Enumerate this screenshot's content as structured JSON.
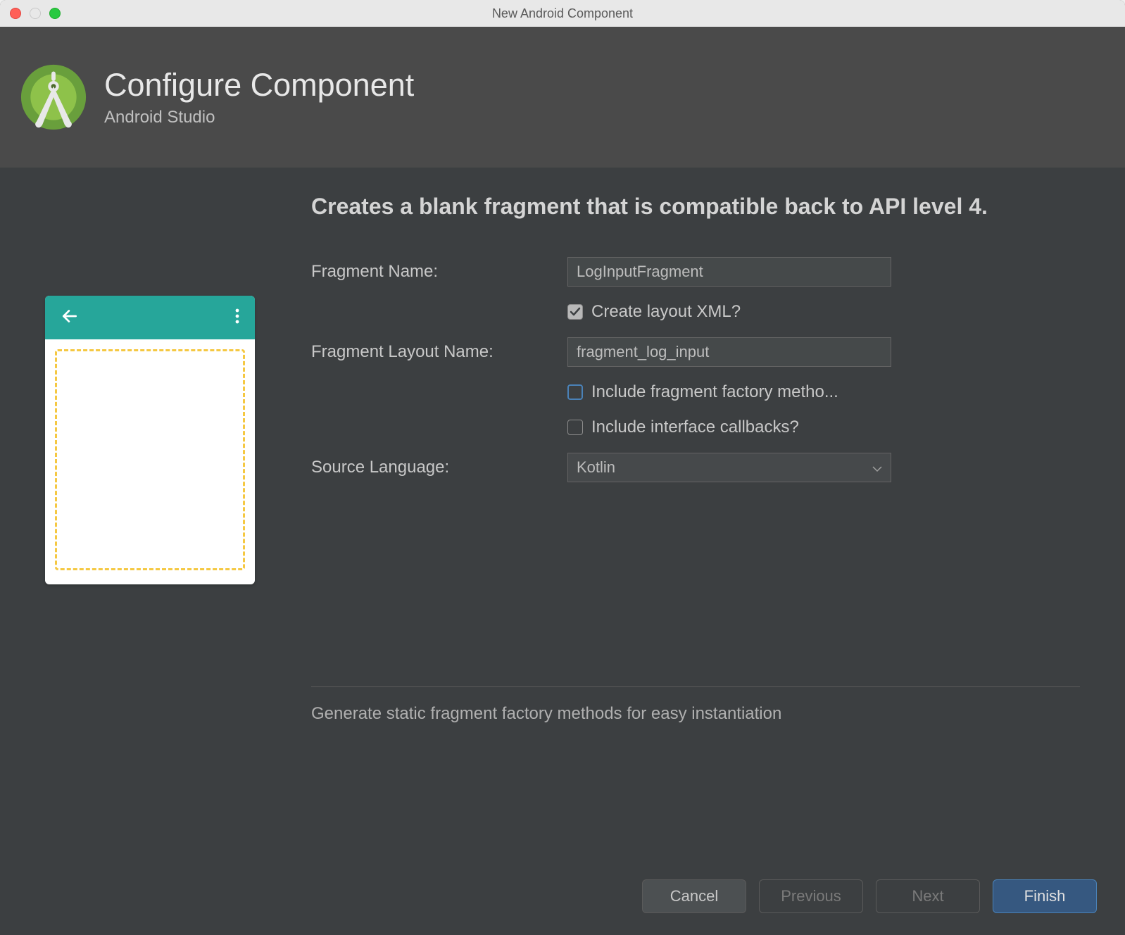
{
  "titlebar": {
    "title": "New Android Component"
  },
  "header": {
    "title": "Configure Component",
    "subtitle": "Android Studio"
  },
  "form": {
    "description": "Creates a blank fragment that is compatible back to API level 4.",
    "fragment_name_label": "Fragment Name:",
    "fragment_name_value": "LogInputFragment",
    "create_layout_label": "Create layout XML?",
    "layout_name_label": "Fragment Layout Name:",
    "layout_name_value": "fragment_log_input",
    "include_factory_label": "Include fragment factory metho...",
    "include_callbacks_label": "Include interface callbacks?",
    "source_lang_label": "Source Language:",
    "source_lang_value": "Kotlin",
    "hint": "Generate static fragment factory methods for easy instantiation"
  },
  "footer": {
    "cancel": "Cancel",
    "previous": "Previous",
    "next": "Next",
    "finish": "Finish"
  },
  "colors": {
    "accent": "#365880",
    "teal": "#26a69a",
    "dashed": "#f5c842"
  }
}
